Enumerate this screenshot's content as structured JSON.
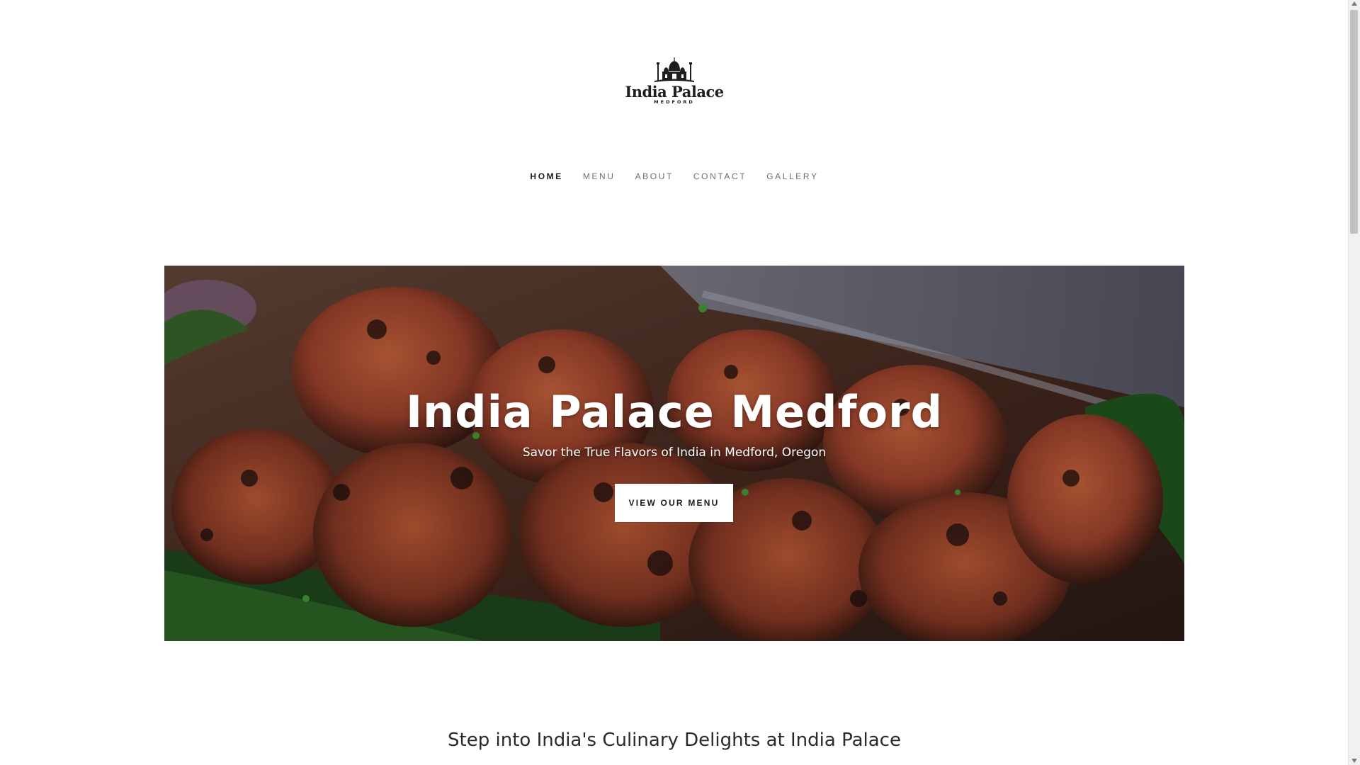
{
  "logo": {
    "name": "India Palace",
    "sub": "MEDFORD"
  },
  "nav": {
    "items": [
      {
        "label": "HOME",
        "active": true
      },
      {
        "label": "MENU",
        "active": false
      },
      {
        "label": "ABOUT",
        "active": false
      },
      {
        "label": "CONTACT",
        "active": false
      },
      {
        "label": "GALLERY",
        "active": false
      }
    ]
  },
  "hero": {
    "title": "India Palace Medford",
    "subtitle": "Savor the True Flavors of India in Medford, Oregon",
    "button_label": "VIEW OUR MENU"
  },
  "intro": {
    "heading": "Step into India's Culinary Delights at India Palace"
  },
  "colors": {
    "nav_active": "#1a1a1a",
    "nav_inactive": "#6e6e6e",
    "button_bg": "#ffffff",
    "text_dark": "#2a2a2a"
  }
}
